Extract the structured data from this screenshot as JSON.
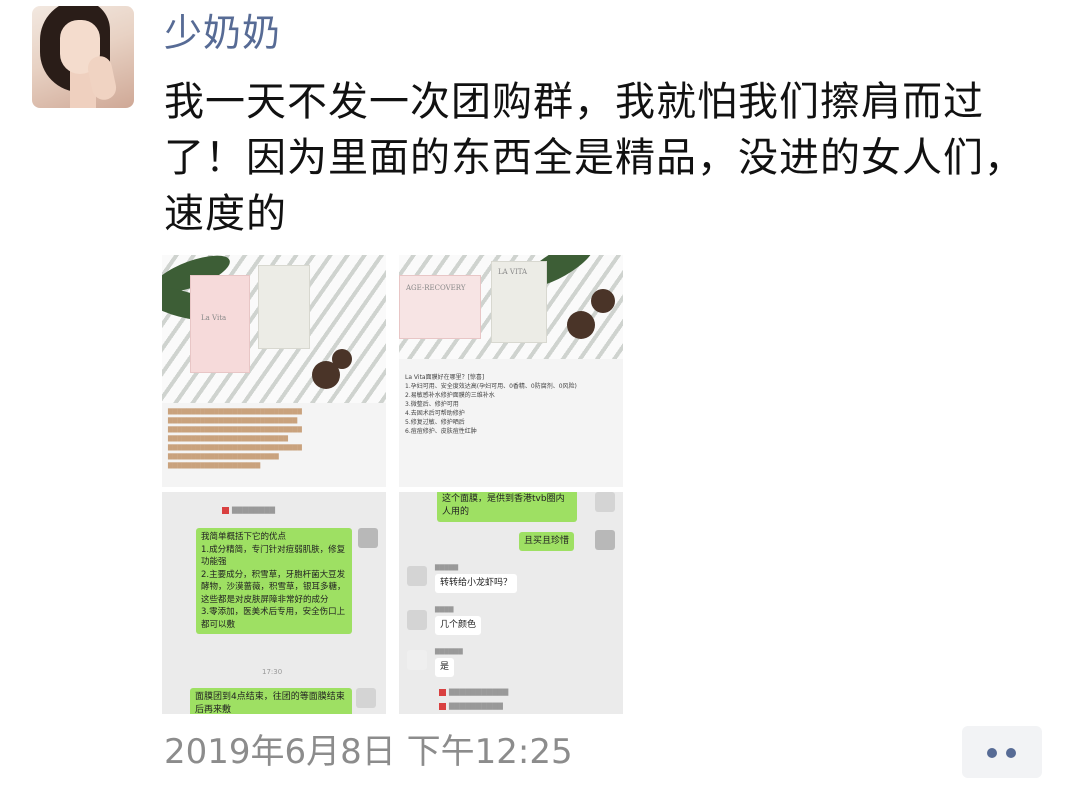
{
  "post": {
    "username": "少奶奶",
    "text": "我一天不发一次团购群，我就怕我们擦肩而过了！因为里面的东西全是精品，没进的女人们，速度的",
    "timestamp": "2019年6月8日 下午12:25",
    "more_icon": "more-dots-icon"
  },
  "images": {
    "img1": {
      "box_label": "La Vita"
    },
    "img2": {
      "box_label": "LA VITA",
      "box_sub": "AGE-RECOVERY",
      "lines": [
        "La Vita面膜好在哪里？[惊喜]",
        "1.孕妇可用、安全度效达高(孕妇可用、0香精、0防腐剂、0风险)",
        "2.易敏感补水修护面膜的三维补水",
        "3.微整后、修护可用",
        "4.去固术后可帮助修护",
        "5.修复过敏、修护晒后",
        "6.痘痘修护、皮肤痘性红肿"
      ]
    },
    "img3": {
      "msg1": "我简单概括下它的优点\n1.成分精简，专门针对痘弱肌肤，修复功能强\n2.主要成分，积雪草，牙胞杆菌大豆发酵物，沙漠蔷薇，积雪草，银耳多糖，这些都是对皮肤屏障非常好的成分\n3.零添加，医美术后专用，安全伤口上都可以敷",
      "time": "17:30",
      "msg2": "面膜团到4点结束，往团的等面膜结束后再来敷"
    },
    "img4": {
      "msg1": "这个面膜，是供到香港tvb圈内人用的",
      "msg2": "且买且珍惜",
      "q1": "转转给小龙虾吗？",
      "q2": "几个颜色",
      "q3": "是"
    }
  }
}
